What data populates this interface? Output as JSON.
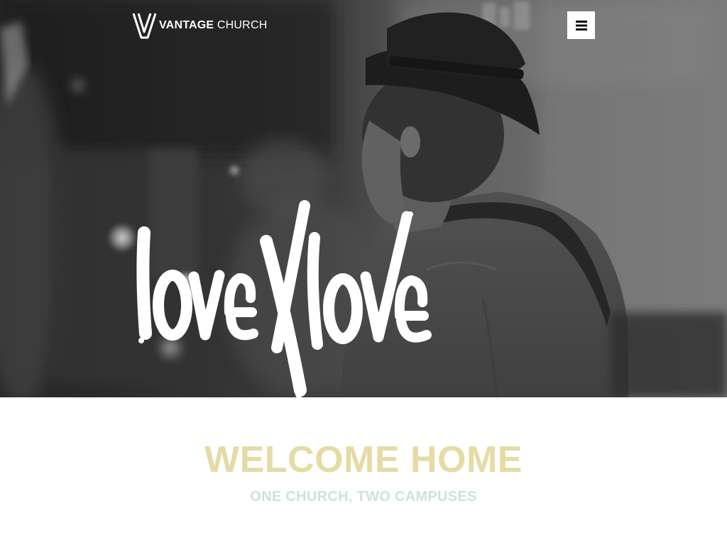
{
  "header": {
    "logo": {
      "brand_strong": "VANTAGE",
      "brand_light": "CHURCH"
    },
    "menu_button": {
      "icon": "hamburger-menu-icon"
    }
  },
  "hero": {
    "image": "black-and-white photo of a guitarist wearing a fedora on stage",
    "brush_lettering": "lovexlove"
  },
  "welcome": {
    "title": "WELCOME HOME",
    "subtitle": "ONE CHURCH, TWO CAMPUSES"
  },
  "colors": {
    "title": "#e5dba4",
    "subtitle": "#cfe1de",
    "hero_overlay": "#3b3b3b",
    "white": "#ffffff"
  }
}
